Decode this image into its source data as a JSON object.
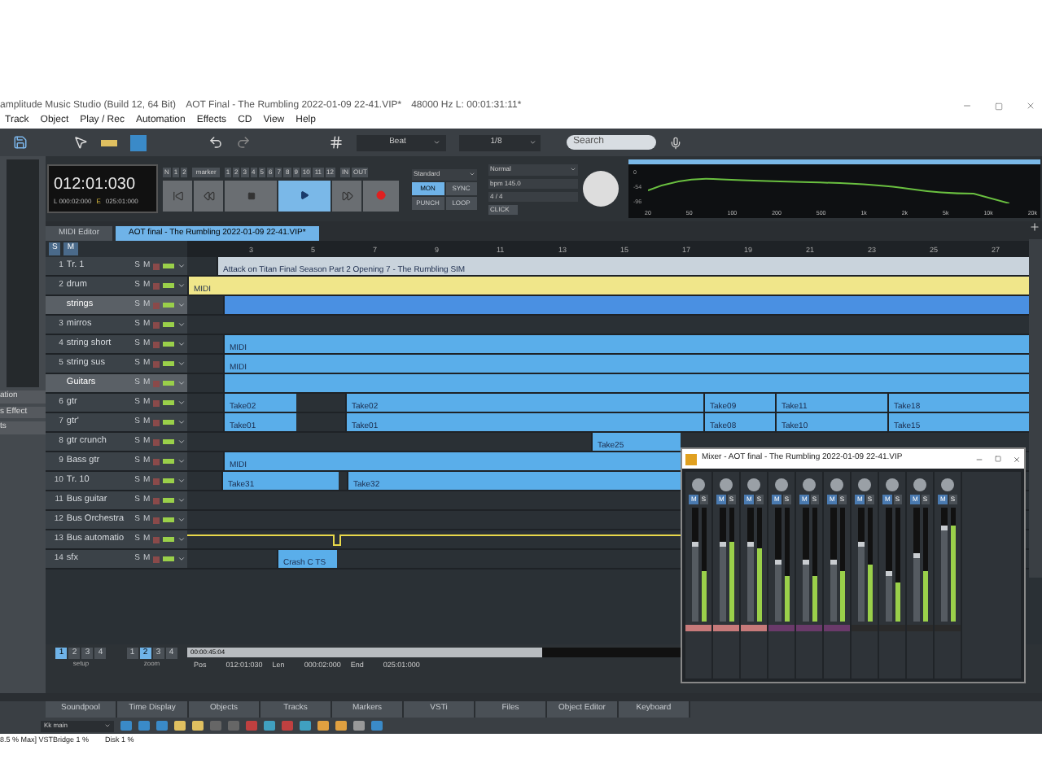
{
  "window": {
    "app_title": "amplitude Music Studio (Build 12, 64 Bit)",
    "project_title": "AOT Final - The Rumbling 2022-01-09 22-41.VIP*",
    "audio_info": "48000 Hz L: 00:01:31:11*"
  },
  "menu": [
    "Track",
    "Object",
    "Play / Rec",
    "Automation",
    "Effects",
    "CD",
    "View",
    "Help"
  ],
  "toolbar": {
    "snap": "Beat",
    "quantize": "1/8",
    "search_placeholder": "Search"
  },
  "left_panel": [
    "ation",
    "s Effect",
    "ts"
  ],
  "transport": {
    "time": "012:01:030",
    "left": "L 000:02:000",
    "end_label": "E",
    "end": "025:01:000",
    "marker_keys": [
      "N",
      "1",
      "2"
    ],
    "marker_label": "marker",
    "markers": [
      "1",
      "2",
      "3",
      "4",
      "5",
      "6",
      "7",
      "8",
      "9",
      "10",
      "11",
      "12"
    ],
    "in": "IN",
    "out": "OUT",
    "mode": "Standard",
    "mode_buttons": [
      {
        "label": "MON",
        "selected": true
      },
      {
        "label": "SYNC",
        "selected": false
      },
      {
        "label": "PUNCH",
        "selected": false
      },
      {
        "label": "LOOP",
        "selected": false
      }
    ],
    "play_mode": "Normal",
    "bpm": "bpm 145.0",
    "signature": "4 / 4",
    "click": "CLICK"
  },
  "spectrum": {
    "y_labels": [
      "0",
      "-54",
      "-96"
    ],
    "x_labels": [
      "20",
      "50",
      "100",
      "200",
      "500",
      "1k",
      "2k",
      "5k",
      "10k",
      "20k"
    ]
  },
  "tabs": [
    {
      "label": "MIDI Editor",
      "selected": false
    },
    {
      "label": "AOT final - The Rumbling 2022-01-09 22-41.VIP*",
      "selected": true
    }
  ],
  "track_view_buttons": [
    "S",
    "M"
  ],
  "ruler": [
    "3",
    "5",
    "7",
    "9",
    "11",
    "13",
    "15",
    "17",
    "19",
    "21",
    "23",
    "25",
    "27"
  ],
  "tracks": [
    {
      "kind": "track",
      "number": "1",
      "name": "Tr. 1",
      "solo": "S",
      "mute": "M",
      "clips": [
        {
          "label": "Attack on Titan Final Season Part 2 Opening 7 - The Rumbling SIM",
          "color": "#c9d3dc"
        }
      ]
    },
    {
      "kind": "track",
      "number": "2",
      "name": "drum",
      "solo": "S",
      "mute": "M",
      "clips": [
        {
          "label": "MIDI",
          "color": "#f0e68a"
        }
      ]
    },
    {
      "kind": "folder",
      "name": "strings",
      "solo": "S",
      "mute": "M",
      "clips": [
        {
          "color": "#4a90e2"
        }
      ]
    },
    {
      "kind": "track",
      "number": "3",
      "name": "mirros",
      "solo": "S",
      "mute": "M"
    },
    {
      "kind": "track",
      "number": "4",
      "name": "string short",
      "solo": "S",
      "mute": "M",
      "clips": [
        {
          "label": "MIDI",
          "color": "#5aaeea"
        }
      ]
    },
    {
      "kind": "track",
      "number": "5",
      "name": "string sus",
      "solo": "S",
      "mute": "M",
      "clips": [
        {
          "label": "MIDI",
          "color": "#5aaeea"
        }
      ]
    },
    {
      "kind": "folder",
      "name": "Guitars",
      "solo": "S",
      "mute": "M",
      "clips": [
        {
          "color": "#5aaeea"
        }
      ]
    },
    {
      "kind": "track",
      "number": "6",
      "name": "gtr",
      "solo": "S",
      "mute": "M",
      "clips": [
        {
          "label": "Take02",
          "color": "#5aaeea"
        },
        {
          "label": "Take02",
          "color": "#5aaeea"
        },
        {
          "label": "Take09",
          "color": "#5aaeea"
        },
        {
          "label": "Take11",
          "color": "#5aaeea"
        },
        {
          "label": "Take18",
          "color": "#5aaeea"
        }
      ]
    },
    {
      "kind": "track",
      "number": "7",
      "name": "gtr'",
      "solo": "S",
      "mute": "M",
      "clips": [
        {
          "label": "Take01",
          "color": "#5aaeea"
        },
        {
          "label": "Take01",
          "color": "#5aaeea"
        },
        {
          "label": "Take08",
          "color": "#5aaeea"
        },
        {
          "label": "Take10",
          "color": "#5aaeea"
        },
        {
          "label": "Take15",
          "color": "#5aaeea"
        }
      ]
    },
    {
      "kind": "track",
      "number": "8",
      "name": "gtr crunch",
      "solo": "S",
      "mute": "M",
      "clips": [
        {
          "label": "Take25",
          "color": "#5aaeea"
        }
      ]
    },
    {
      "kind": "track",
      "number": "9",
      "name": "Bass gtr",
      "solo": "S",
      "mute": "M",
      "clips": [
        {
          "label": "MIDI",
          "color": "#5aaeea"
        }
      ]
    },
    {
      "kind": "track",
      "number": "10",
      "name": "Tr. 10",
      "solo": "S",
      "mute": "M",
      "clips": [
        {
          "label": "Take31",
          "color": "#5aaeea"
        },
        {
          "label": "Take32",
          "color": "#5aaeea"
        }
      ]
    },
    {
      "kind": "track",
      "number": "11",
      "name": "Bus  guitar",
      "solo": "S",
      "mute": "M"
    },
    {
      "kind": "track",
      "number": "12",
      "name": "Bus  Orchestra",
      "solo": "S",
      "mute": "M"
    },
    {
      "kind": "automation",
      "number": "13",
      "name": "Bus  automatio",
      "solo": "S",
      "mute": "M"
    },
    {
      "kind": "track",
      "number": "14",
      "name": "sfx",
      "solo": "S",
      "mute": "M",
      "clips": [
        {
          "label": "Crash C   TS",
          "color": "#5aaeea"
        }
      ]
    }
  ],
  "bottom": {
    "setup": [
      {
        "label": "1",
        "selected": true
      },
      {
        "label": "2",
        "selected": false
      },
      {
        "label": "3",
        "selected": false
      },
      {
        "label": "4",
        "selected": false
      }
    ],
    "setup_label": "setup",
    "zoom": [
      {
        "label": "1",
        "selected": false
      },
      {
        "label": "2",
        "selected": true
      },
      {
        "label": "3",
        "selected": false
      },
      {
        "label": "4",
        "selected": false
      }
    ],
    "zoom_label": "zoom",
    "position": "00:00:45:04",
    "pos_label": "Pos",
    "pos": "012:01:030",
    "len_label": "Len",
    "len": "000:02:000",
    "end_label": "End",
    "end": "025:01:000",
    "scroll": {
      "level": 0.72
    }
  },
  "dock_tabs": [
    {
      "label": "Soundpool",
      "selected": false
    },
    {
      "label": "Time Display",
      "selected": false
    },
    {
      "label": "Objects",
      "selected": false
    },
    {
      "label": "Tracks",
      "selected": false
    },
    {
      "label": "Markers",
      "selected": false
    },
    {
      "label": "VSTi",
      "selected": false
    },
    {
      "label": "Files",
      "selected": false
    },
    {
      "label": "Object Editor",
      "selected": false
    },
    {
      "label": "Keyboard",
      "selected": false
    }
  ],
  "bottom_toolbar": {
    "preset": "Kk main"
  },
  "status": [
    "8.5 % Max]  VSTBridge 1 %",
    "Disk  1 %"
  ],
  "mixer": {
    "title": "Mixer - AOT final - The Rumbling 2022-01-09 22-41.VIP",
    "channels": [
      {
        "m": "M",
        "s": "S",
        "fader": {
          "level": 0.7
        },
        "meter": {
          "level": 0.45
        },
        "color": "#c77a7a"
      },
      {
        "m": "M",
        "s": "S",
        "fader": {
          "level": 0.7
        },
        "meter": {
          "level": 0.7
        },
        "color": "#c77a7a"
      },
      {
        "m": "M",
        "s": "S",
        "fader": {
          "level": 0.7
        },
        "meter": {
          "level": 0.65
        },
        "color": "#c77a7a"
      },
      {
        "m": "M",
        "s": "S",
        "fader": {
          "level": 0.55
        },
        "meter": {
          "level": 0.4
        },
        "color": "#6a3a6a"
      },
      {
        "m": "M",
        "s": "S",
        "fader": {
          "level": 0.55
        },
        "meter": {
          "level": 0.4
        },
        "color": "#6a3a6a"
      },
      {
        "m": "M",
        "s": "S",
        "fader": {
          "level": 0.55
        },
        "meter": {
          "level": 0.45
        },
        "color": "#6a3a6a"
      },
      {
        "m": "M",
        "s": "S",
        "fader": {
          "level": 0.7
        },
        "meter": {
          "level": 0.5
        },
        "color": "#2a2a2a"
      },
      {
        "m": "M",
        "s": "S",
        "fader": {
          "level": 0.45
        },
        "meter": {
          "level": 0.35
        },
        "color": "#2a2a2a"
      },
      {
        "m": "M",
        "s": "S",
        "fader": {
          "level": 0.6
        },
        "meter": {
          "level": 0.45
        },
        "color": "#2a2a2a"
      },
      {
        "m": "M",
        "s": "S",
        "fader": {
          "level": 0.85
        },
        "meter": {
          "level": 0.85
        },
        "color": "#2a2a2a"
      }
    ]
  }
}
